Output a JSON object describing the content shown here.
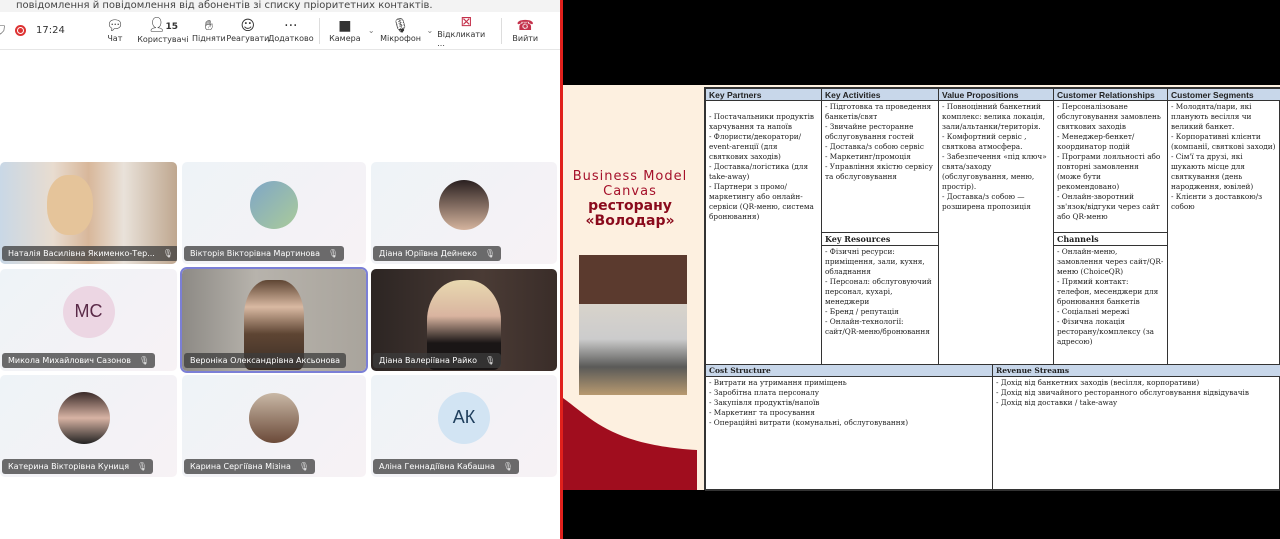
{
  "banner": "повідомлення й повідомлення від абонентів зі списку пріоритетних контактів.",
  "toolbar": {
    "time": "17:24",
    "participants_count": "15",
    "chat": "Чат",
    "people": "Користувачі",
    "raise": "Підняти",
    "react": "Реагувати",
    "more": "Додатково",
    "camera": "Камера",
    "mic": "Мікрофон",
    "share": "Відкликати ...",
    "leave": "Вийти"
  },
  "tiles": [
    {
      "name": "Наталія Василівна Якименко-Тер..."
    },
    {
      "name": "Вікторія Вікторівна Мартинова"
    },
    {
      "name": "Діана Юріївна Дейнеко"
    },
    {
      "name": "Микола Михайлович Сазонов",
      "initials": "МС"
    },
    {
      "name": "Вероніка Олександрівна Аксьонова"
    },
    {
      "name": "Діана Валеріївна Райко"
    },
    {
      "name": "Катерина Вікторівна Куниця"
    },
    {
      "name": "Карина Сергіївна Мізіна"
    },
    {
      "name": "Аліна Геннадіївна Кабашна",
      "initials": "АК"
    }
  ],
  "slide": {
    "title1": "Business Model",
    "title2": "Canvas",
    "title3": "ресторану",
    "title4": "«Володар»"
  },
  "bmc": {
    "key_partners": {
      "title": "Key Partners",
      "text": "\n - Постачальники продуктів харчування та напоїв\n- Флористи/декоратори/ event-агенції (для святкових заходів)\n- Доставка/логістика (для take-away)\n- Партнери з промо/маркетингу або онлайн-сервіси (QR-меню, система бронювання)"
    },
    "key_activities": {
      "title": "Key Activities",
      "text": "- Підготовка та проведення банкетів/свят\n- Звичайне ресторанне обслуговування гостей\n- Доставка/з собою сервіс\n- Маркетинг/промоція\n- Управління якістю сервісу та обслуговування"
    },
    "value_propositions": {
      "title": "Value Propositions",
      "text": "- Повноцінний банкетний комплекс: велика локація, зали/альтанки/територія.\n- Комфортний сервіс , святкова атмосфера.\n- Забезпечення «під ключ» свята/заходу (обслуговування, меню, простір).\n- Доставка/з собою — розширена пропозиція"
    },
    "customer_relationships": {
      "title": "Customer Relationships",
      "text": "- Персоналізоване обслуговування замовлень святкових заходів\n- Менеджер-бенкет/координатор подій\n- Програми лояльності або повторні замовлення (може бути рекомендовано)\n- Онлайн-зворотний зв'язок/відгуки через сайт або QR-меню"
    },
    "customer_segments": {
      "title": "Customer Segments",
      "text": "- Молодята/пари, які планують весілля чи великий банкет.\n- Корпоративні клієнти (компанії, святкові заходи)\n- Сім'ї та друзі, які шукають місце для святкування (день народження, ювілей)\n- Клієнти з доставкою/з собою"
    },
    "key_resources": {
      "title": "Key Resources",
      "text": "- Фізичні ресурси: приміщення, зали, кухня, обладнання\n- Персонал: обслуговуючий персонал, кухарі, менеджери\n- Бренд / репутація\n- Онлайн-технології: сайт/QR-меню/бронювання"
    },
    "channels": {
      "title": "Channels",
      "text": "- Онлайн-меню, замовлення через сайт/QR-меню (ChoiceQR)\n- Прямий контакт: телефон, месенджери для бронювання банкетів\n- Соціальні мережі\n- Фізична локація ресторану/комплексу (за адресою)"
    },
    "cost_structure": {
      "title": "Cost Structure",
      "text": "- Витрати на утримання приміщень\n- Заробітна плата персоналу\n- Закупівля продуктів/напоїв\n- Маркетинг та просування\n- Операційні витрати (комунальні, обслуговування)"
    },
    "revenue_streams": {
      "title": "Revenue Streams",
      "text": "- Дохід від банкетних заходів (весілля, корпоративи)\n- Дохід від звичайного ресторанного обслуговування відвідувачів\n- Дохід від доставки / take-away"
    }
  }
}
